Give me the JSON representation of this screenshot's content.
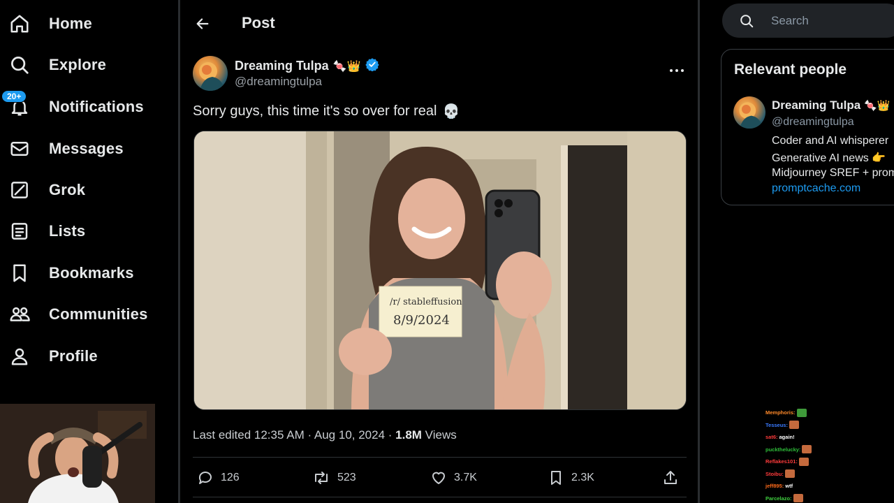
{
  "nav": {
    "items": [
      {
        "label": "Home",
        "icon": "home-icon"
      },
      {
        "label": "Explore",
        "icon": "search-icon"
      },
      {
        "label": "Notifications",
        "icon": "bell-icon",
        "badge": "20+"
      },
      {
        "label": "Messages",
        "icon": "envelope-icon"
      },
      {
        "label": "Grok",
        "icon": "grok-icon"
      },
      {
        "label": "Lists",
        "icon": "list-icon"
      },
      {
        "label": "Bookmarks",
        "icon": "bookmark-icon"
      },
      {
        "label": "Communities",
        "icon": "people-icon"
      },
      {
        "label": "Profile",
        "icon": "person-icon"
      }
    ]
  },
  "header": {
    "title": "Post"
  },
  "post": {
    "author_name": "Dreaming Tulpa",
    "author_emoji": "🍬👑",
    "author_handle": "@dreamingtulpa",
    "text": "Sorry guys, this time it's so over for real",
    "text_emoji": "💀",
    "media_sign": {
      "line1": "/r/ stableffusion",
      "line2": "8/9/2024"
    },
    "meta": {
      "edited": "Last edited 12:35 AM · Aug 10, 2024 · ",
      "views_count": "1.8M",
      "views_label": " Views"
    },
    "actions": {
      "replies": "126",
      "reposts": "523",
      "likes": "3.7K",
      "bookmarks": "2.3K"
    }
  },
  "search": {
    "placeholder": "Search"
  },
  "relevant_people": {
    "title": "Relevant people",
    "name": "Dreaming Tulpa",
    "name_emoji": "🍬👑",
    "handle": "@dreamingtulpa",
    "bio_lines": [
      "Coder and AI whisperer",
      "Generative AI news 👉",
      "Midjourney SREF + prom"
    ],
    "link": "promptcache.com"
  },
  "chat": [
    {
      "user": "Memphoris:",
      "msg": "",
      "color": "#ff8a2a"
    },
    {
      "user": "Tesseus:",
      "msg": "",
      "color": "#3a7bff"
    },
    {
      "user": "sat6:",
      "msg": "again!",
      "color": "#ff3b3b"
    },
    {
      "user": "puckthelucky:",
      "msg": "",
      "color": "#2fbf3a"
    },
    {
      "user": "Reflakes101:",
      "msg": "",
      "color": "#ff3b3b"
    },
    {
      "user": "Stoibu:",
      "msg": "",
      "color": "#ff3b3b"
    },
    {
      "user": "jeff895:",
      "msg": "wtf",
      "color": "#ff6a1a"
    },
    {
      "user": "Parcelazo:",
      "msg": "",
      "color": "#3fd13f"
    }
  ],
  "colors": {
    "accent": "#1d9bf0",
    "background": "#000000",
    "border": "#2f3336"
  }
}
